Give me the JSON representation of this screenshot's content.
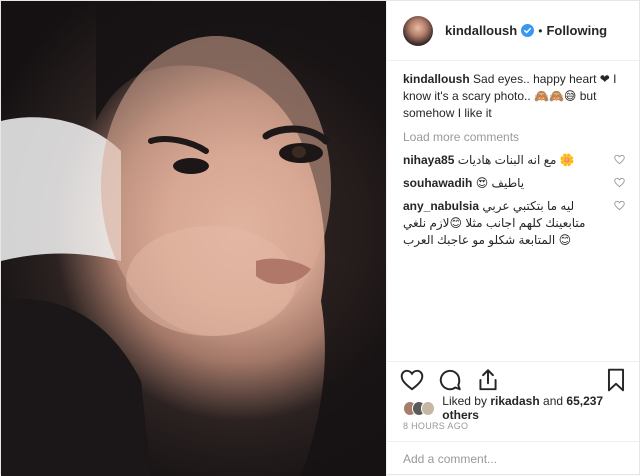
{
  "header": {
    "username": "kindalloush",
    "separator": "•",
    "follow_status": "Following"
  },
  "caption": {
    "username": "kindalloush",
    "text": "Sad eyes.. happy heart ❤ I know it's a scary photo.. 🙈🙈😅 but somehow I like it"
  },
  "load_more": "Load more comments",
  "comments": [
    {
      "username": "nihaya85",
      "text": "مع انه البنات هاديات 🌼"
    },
    {
      "username": "souhawadih",
      "text": "😍 ياطيف"
    },
    {
      "username": "any_nabulsia",
      "text": "ليه ما بتكتبي عربي متابعينك كلهم اجانب مثلا 😊لازم نلغي المتابعة شكلو مو عاجبك العرب 😊"
    }
  ],
  "likes": {
    "prefix": "Liked by",
    "user": "rikadash",
    "middle": "and",
    "count": "65,237 others"
  },
  "timestamp": "8 HOURS AGO",
  "add_comment": {
    "placeholder": "Add a comment..."
  }
}
